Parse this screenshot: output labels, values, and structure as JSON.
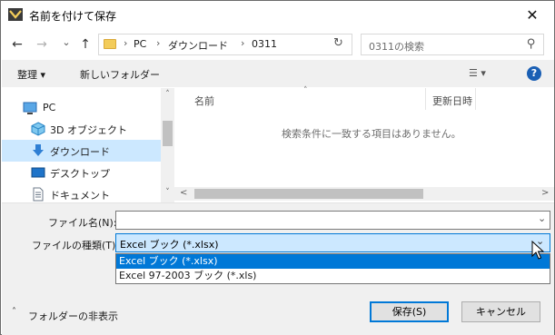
{
  "window": {
    "title": "名前を付けて保存",
    "close_glyph": "✕"
  },
  "nav": {
    "back_glyph": "←",
    "forward_glyph": "→",
    "recent_glyph": "⌄",
    "up_glyph": "↑"
  },
  "address": {
    "crumbs": [
      "PC",
      "ダウンロード",
      "0311"
    ],
    "separator": "›",
    "dropdown_glyph": "⌄",
    "refresh_glyph": "↻"
  },
  "search": {
    "placeholder": "0311の検索",
    "icon_glyph": "⚲"
  },
  "toolbar": {
    "organize_label": "整理 ▾",
    "new_folder_label": "新しいフォルダー",
    "view_glyph": "☰ ▾",
    "help_glyph": "?"
  },
  "nav_pane": {
    "items": [
      {
        "label": "PC",
        "icon": "pc-icon"
      },
      {
        "label": "3D オブジェクト",
        "icon": "3d-objects-icon"
      },
      {
        "label": "ダウンロード",
        "icon": "download-icon",
        "selected": true
      },
      {
        "label": "デスクトップ",
        "icon": "desktop-icon"
      },
      {
        "label": "ドキュメント",
        "icon": "documents-icon"
      }
    ],
    "scroll_up": "˄",
    "scroll_down": "˅"
  },
  "file_list": {
    "columns": [
      "名前",
      "更新日時"
    ],
    "sort_glyph": "˄",
    "empty_message": "検索条件に一致する項目はありません。",
    "scroll_left": "<",
    "scroll_right": ">"
  },
  "form": {
    "file_name_label": "ファイル名(N):",
    "file_name_value": "",
    "file_type_label": "ファイルの種類(T):",
    "file_type_value": "Excel ブック (*.xlsx)",
    "dropdown_glyph": "⌄",
    "file_type_options": [
      {
        "label": "Excel ブック (*.xlsx)",
        "active": true
      },
      {
        "label": "Excel 97-2003 ブック (*.xls)",
        "active": false
      }
    ]
  },
  "footer": {
    "hide_folders_label": "フォルダーの非表示",
    "hide_folders_glyph": "˄",
    "save_label": "保存(S)",
    "cancel_label": "キャンセル"
  },
  "colors": {
    "accent": "#0078d7",
    "selection": "#cce8ff",
    "panel": "#f0f0f0"
  }
}
